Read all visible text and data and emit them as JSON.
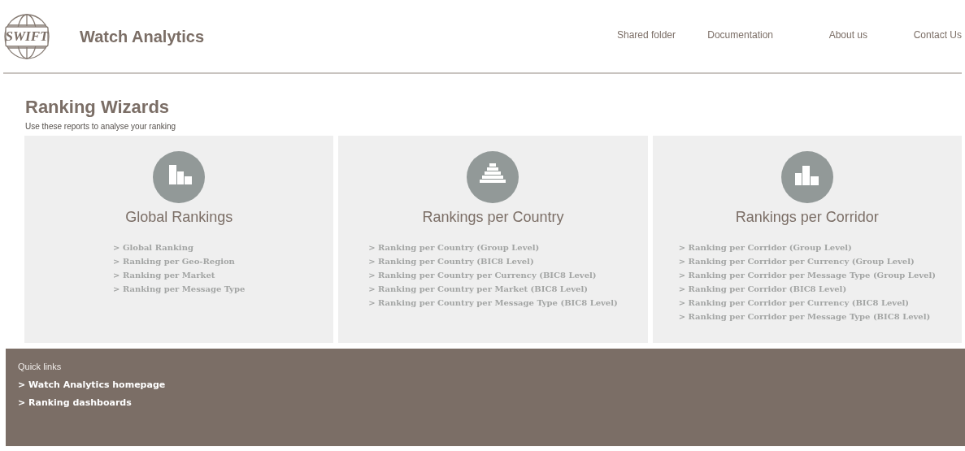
{
  "header": {
    "logo_text": "SWIFT",
    "app_title": "Watch Analytics",
    "nav": [
      "Shared folder",
      "Documentation",
      "About us",
      "Contact Us"
    ]
  },
  "page": {
    "title": "Ranking Wizards",
    "subtitle": "Use these reports to analyse your ranking"
  },
  "cards": [
    {
      "kind": "descending",
      "title": "Global Rankings",
      "links": [
        "> Global Ranking",
        "> Ranking per Geo-Region",
        "> Ranking per Market",
        "> Ranking per Message Type"
      ]
    },
    {
      "kind": "pyramid",
      "title": "Rankings per Country",
      "links": [
        "> Ranking per Country (Group Level)",
        "> Ranking per Country (BIC8 Level)",
        "> Ranking per Country per Currency (BIC8 Level)",
        "> Ranking per Country per Market (BIC8 Level)",
        "> Ranking per Country per Message Type (BIC8 Level)"
      ]
    },
    {
      "kind": "podium",
      "title": "Rankings per Corridor",
      "links": [
        "> Ranking per Corridor (Group Level)",
        "> Ranking per Corridor per Currency (Group Level)",
        "> Ranking per Corridor per Message Type (Group Level)",
        "> Ranking per Corridor (BIC8 Level)",
        "> Ranking per Corridor per Currency (BIC8 Level)",
        "> Ranking per Corridor per Message Type (BIC8 Level)"
      ]
    }
  ],
  "footer": {
    "title": "Quick links",
    "links": [
      "> Watch Analytics homepage",
      "> Ranking dashboards"
    ]
  }
}
